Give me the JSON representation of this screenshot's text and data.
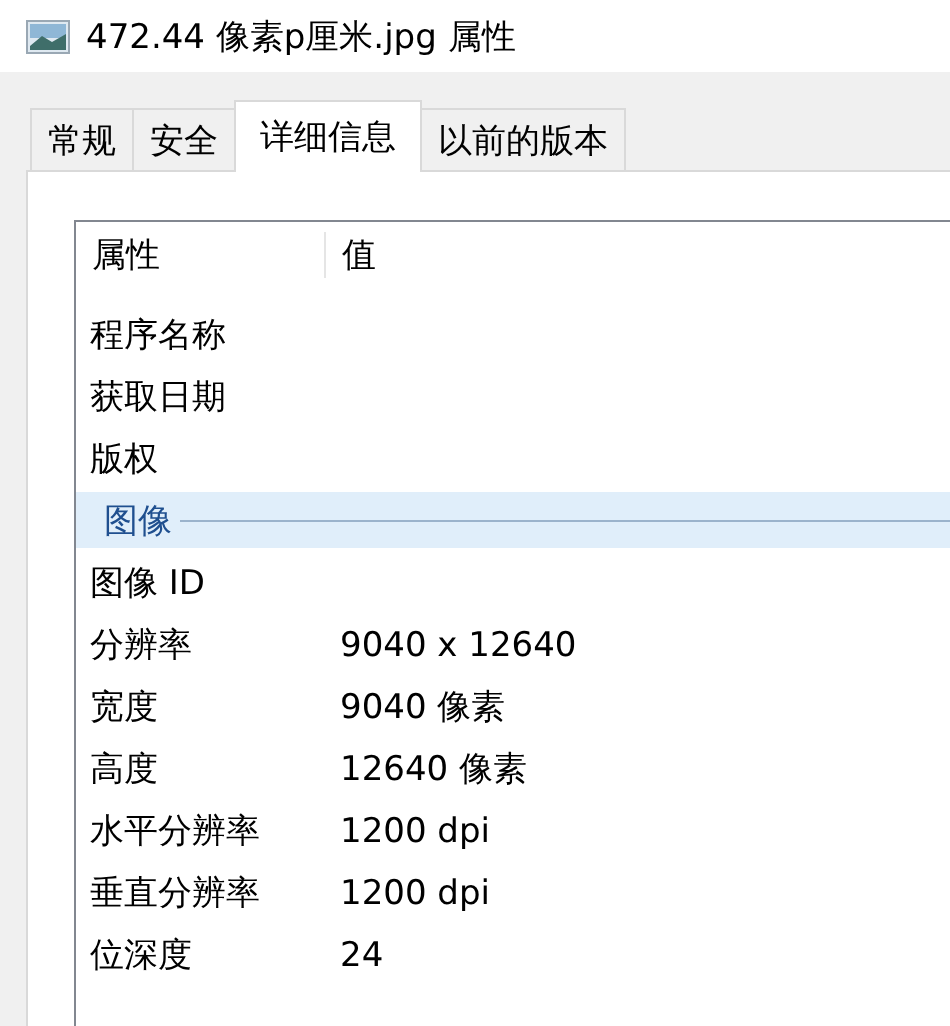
{
  "window": {
    "title": "472.44 像素p厘米.jpg 属性"
  },
  "tabs": [
    {
      "label": "常规",
      "selected": false
    },
    {
      "label": "安全",
      "selected": false
    },
    {
      "label": "详细信息",
      "selected": true
    },
    {
      "label": "以前的版本",
      "selected": false
    }
  ],
  "details": {
    "columns": [
      "属性",
      "值"
    ],
    "rows": [
      {
        "kind": "item",
        "name": "程序名称"
      },
      {
        "kind": "item",
        "name": "获取日期"
      },
      {
        "kind": "item",
        "name": "版权"
      },
      {
        "kind": "group",
        "name": "图像"
      },
      {
        "kind": "item",
        "name": "图像 ID"
      },
      {
        "kind": "item",
        "name": "分辨率",
        "value": "9040 x 12640"
      },
      {
        "kind": "item",
        "name": "宽度",
        "value": "9040 像素"
      },
      {
        "kind": "item",
        "name": "高度",
        "value": "12640 像素"
      },
      {
        "kind": "item",
        "name": "水平分辨率",
        "value": "1200 dpi"
      },
      {
        "kind": "item",
        "name": "垂直分辨率",
        "value": "1200 dpi"
      },
      {
        "kind": "item",
        "name": "位深度",
        "value": "24"
      }
    ]
  }
}
